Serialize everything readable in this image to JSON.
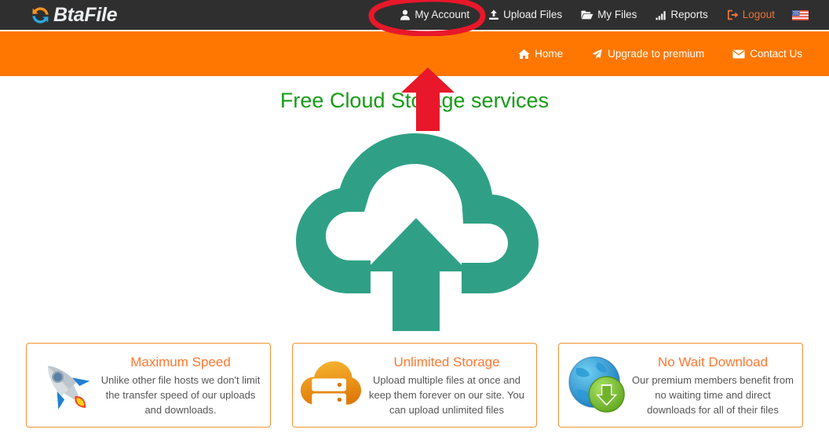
{
  "brand": {
    "name": "BtaFile",
    "icon": "sync-refresh-icon",
    "icon_colors": {
      "top_arrow": "#f7941e",
      "bottom_arrow": "#29abe2"
    },
    "text_color": "#eceff1"
  },
  "topbar": {
    "background": "#2f2f2f",
    "items": [
      {
        "label": "My Account",
        "icon": "user-icon",
        "color": "#f3f3f3"
      },
      {
        "label": "Upload Files",
        "icon": "upload-icon",
        "color": "#f3f3f3"
      },
      {
        "label": "My Files",
        "icon": "folder-icon",
        "color": "#f3f3f3"
      },
      {
        "label": "Reports",
        "icon": "bar-chart-icon",
        "color": "#f3f3f3"
      },
      {
        "label": "Logout",
        "icon": "sign-out-icon",
        "color": "#e8743b"
      }
    ],
    "language_flag": "us-flag-icon"
  },
  "orangebar": {
    "background": "#ff7700",
    "items": [
      {
        "label": "Home",
        "icon": "home-icon"
      },
      {
        "label": "Upgrade to premium",
        "icon": "rocket-paper-plane-icon"
      },
      {
        "label": "Contact Us",
        "icon": "envelope-icon"
      }
    ]
  },
  "hero": {
    "title": "Free Cloud Storage services",
    "title_color": "#179b17",
    "graphic": "cloud-upload-icon",
    "graphic_color": "#2fa086"
  },
  "features": [
    {
      "title": "Maximum Speed",
      "description": "Unlike other file hosts we don't limit the transfer speed of our uploads and downloads.",
      "icon": "rocket-icon"
    },
    {
      "title": "Unlimited Storage",
      "description": "Upload multiple files at once and keep them forever on our site. You can upload unlimited files",
      "icon": "cloud-server-icon"
    },
    {
      "title": "No Wait Download",
      "description": "Our premium members benefit from no waiting time and direct downloads for all of their files",
      "icon": "globe-download-icon"
    }
  ],
  "annotations": {
    "color": "#e8182a",
    "items": [
      {
        "shape": "ellipse",
        "target": "My Account",
        "name": "annotation-circle-my-account"
      },
      {
        "shape": "arrow-up",
        "target": "My Account",
        "name": "annotation-arrow-up"
      }
    ]
  }
}
